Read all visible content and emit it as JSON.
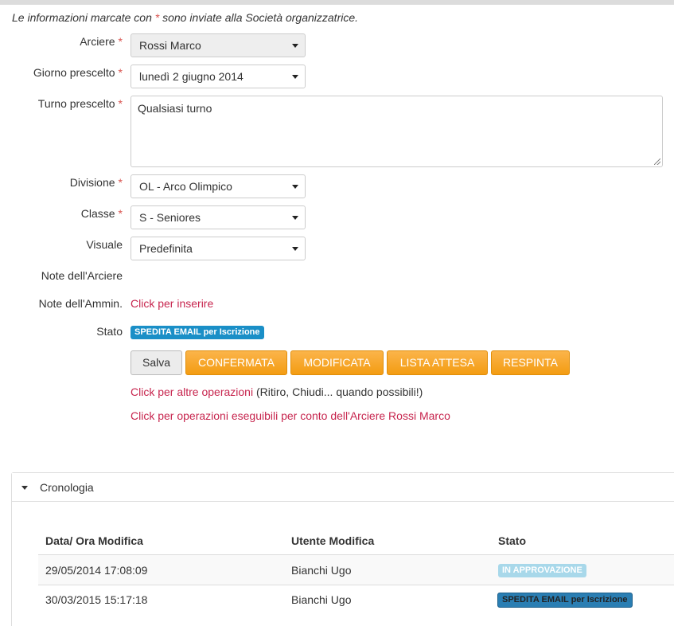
{
  "intro": {
    "before": "Le informazioni marcate con ",
    "star": "*",
    "after": " sono inviate alla Società organizzatrice."
  },
  "form": {
    "required_mark": "*",
    "arciere": {
      "label": "Arciere",
      "value": "Rossi Marco"
    },
    "giorno": {
      "label": "Giorno prescelto",
      "value": "lunedì 2 giugno 2014"
    },
    "turno": {
      "label": "Turno prescelto",
      "value": "Qualsiasi turno"
    },
    "divisione": {
      "label": "Divisione",
      "value": "OL - Arco Olimpico"
    },
    "classe": {
      "label": "Classe",
      "value": "S - Seniores"
    },
    "visuale": {
      "label": "Visuale",
      "value": "Predefinita"
    },
    "note_arciere": {
      "label": "Note dell'Arciere",
      "value": ""
    },
    "note_ammin": {
      "label": "Note dell'Ammin.",
      "link": "Click per inserire"
    },
    "stato": {
      "label": "Stato",
      "badge": "SPEDITA EMAIL per Iscrizione"
    }
  },
  "buttons": {
    "salva": "Salva",
    "confermata": "CONFERMATA",
    "modificata": "MODIFICATA",
    "lista_attesa": "LISTA ATTESA",
    "respinta": "RESPINTA"
  },
  "links": {
    "altre_operazioni": "Click per altre operazioni",
    "altre_operazioni_note": " (Ritiro, Chiudi... quando possibili!)",
    "operazioni_conto": "Click per operazioni eseguibili per conto dell'Arciere Rossi Marco"
  },
  "cronologia": {
    "title": "Cronologia",
    "headers": [
      "Data/ Ora Modifica",
      "Utente Modifica",
      "Stato"
    ],
    "rows": [
      {
        "data": "29/05/2014 17:08:09",
        "utente": "Bianchi Ugo",
        "stato": "IN APPROVAZIONE"
      },
      {
        "data": "30/03/2015 15:17:18",
        "utente": "Bianchi Ugo",
        "stato": "SPEDITA EMAIL per Iscrizione"
      }
    ]
  },
  "colors": {
    "required": "#d9534f",
    "link": "#c7254e",
    "orange_button": "#f39c12",
    "badge_blue": "#1a8fc7"
  }
}
